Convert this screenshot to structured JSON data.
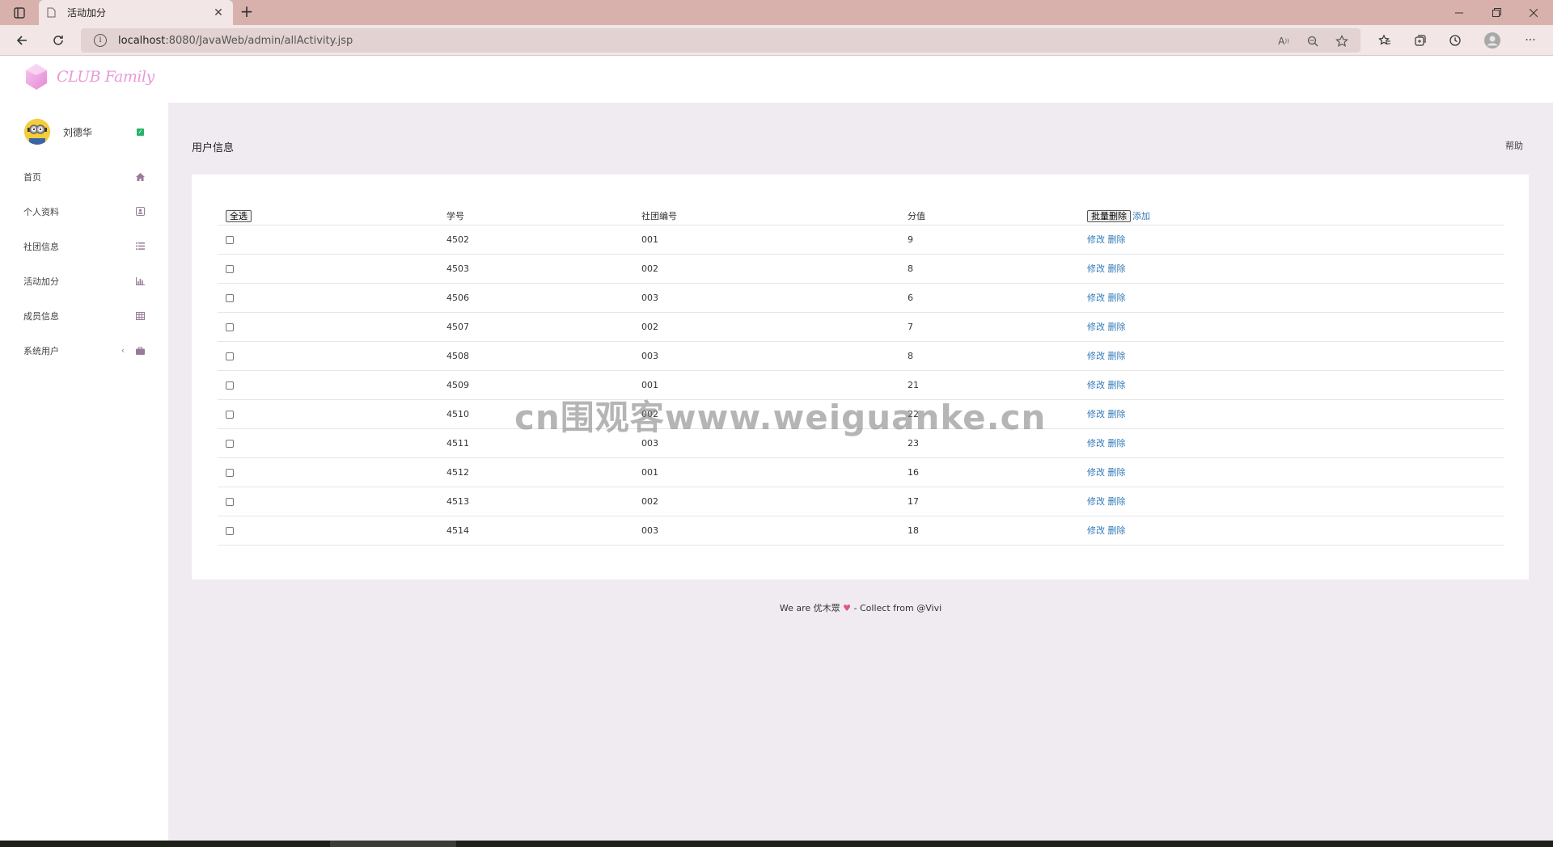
{
  "browser": {
    "tab_title": "活动加分",
    "url_host": "localhost",
    "url_path": ":8080/JavaWeb/admin/allActivity.jsp"
  },
  "app": {
    "logo_text": "CLUB Family",
    "user_name": "刘德华",
    "nav": [
      {
        "label": "首页",
        "icon": "home-icon"
      },
      {
        "label": "个人资料",
        "icon": "profile-card-icon"
      },
      {
        "label": "社团信息",
        "icon": "list-icon"
      },
      {
        "label": "活动加分",
        "icon": "bar-chart-icon"
      },
      {
        "label": "成员信息",
        "icon": "table-icon"
      },
      {
        "label": "系统用户",
        "icon": "briefcase-icon"
      }
    ],
    "page_title": "用户信息",
    "help_label": "帮助"
  },
  "table": {
    "select_all_label": "全选",
    "batch_delete_label": "批量删除",
    "add_label": "添加",
    "headers": {
      "id": "学号",
      "club": "社团编号",
      "score": "分值"
    },
    "edit_label": "修改",
    "delete_label": "删除",
    "rows": [
      {
        "id": "4502",
        "club": "001",
        "score": "9"
      },
      {
        "id": "4503",
        "club": "002",
        "score": "8"
      },
      {
        "id": "4506",
        "club": "003",
        "score": "6"
      },
      {
        "id": "4507",
        "club": "002",
        "score": "7"
      },
      {
        "id": "4508",
        "club": "003",
        "score": "8"
      },
      {
        "id": "4509",
        "club": "001",
        "score": "21"
      },
      {
        "id": "4510",
        "club": "002",
        "score": "22"
      },
      {
        "id": "4511",
        "club": "003",
        "score": "23"
      },
      {
        "id": "4512",
        "club": "001",
        "score": "16"
      },
      {
        "id": "4513",
        "club": "002",
        "score": "17"
      },
      {
        "id": "4514",
        "club": "003",
        "score": "18"
      }
    ]
  },
  "footer": {
    "prefix": "We are 优木眾",
    "suffix": "- Collect from @Vivi"
  },
  "watermark": "cn围观客www.weiguanke.cn",
  "colors": {
    "accent": "#337ab7",
    "tabbar": "#d9b1ac",
    "main_bg": "#f0ebf1"
  }
}
